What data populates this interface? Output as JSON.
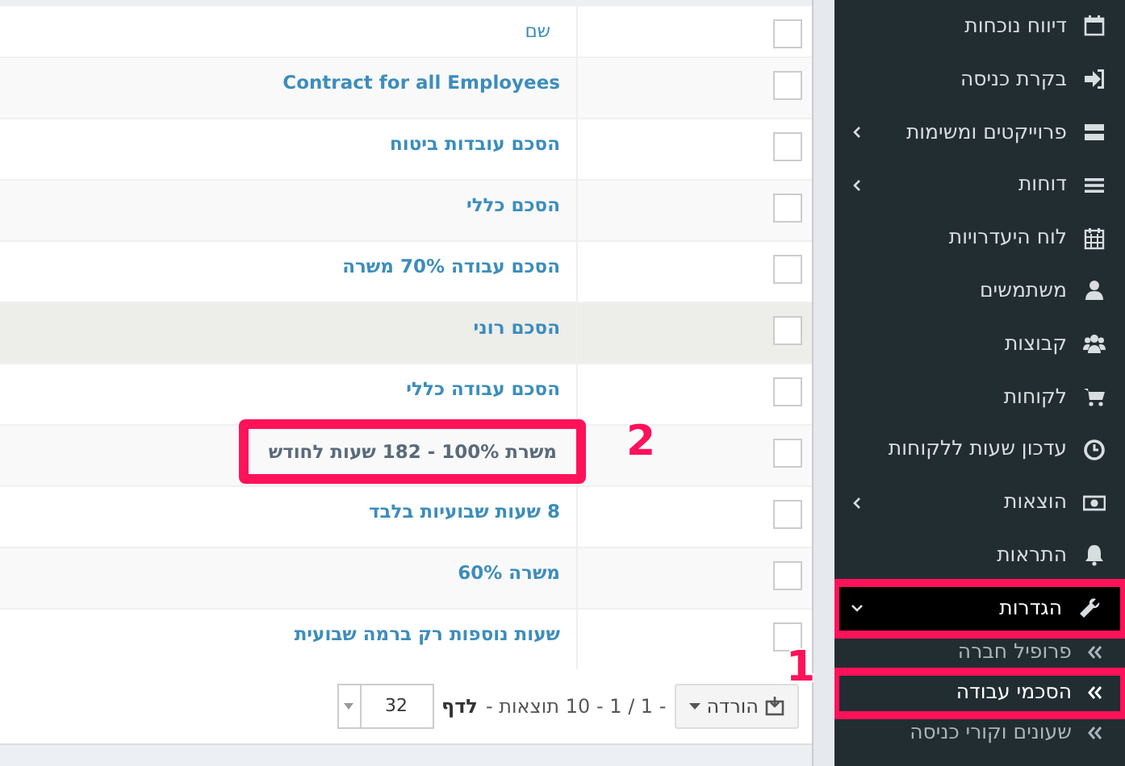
{
  "table": {
    "columns": [
      {
        "label": "שם"
      }
    ],
    "header_checkbox": {
      "checked": false
    },
    "rows": [
      {
        "name": "Contract for all Employees",
        "checked": false,
        "hovered": false,
        "outlined": false
      },
      {
        "name": "הסכם עובדות ביטוח",
        "checked": false,
        "hovered": false,
        "outlined": false
      },
      {
        "name": "הסכם כללי",
        "checked": false,
        "hovered": false,
        "outlined": false
      },
      {
        "name": "הסכם עבודה 70% משרה",
        "checked": false,
        "hovered": false,
        "outlined": false
      },
      {
        "name": "הסכם רוני",
        "checked": false,
        "hovered": true,
        "outlined": false
      },
      {
        "name": "הסכם עבודה כללי",
        "checked": false,
        "hovered": false,
        "outlined": false
      },
      {
        "name": "משרת 100% - 182 שעות לחודש",
        "checked": false,
        "hovered": false,
        "outlined": true
      },
      {
        "name": "8 שעות שבועיות בלבד",
        "checked": false,
        "hovered": false,
        "outlined": false
      },
      {
        "name": "משרה 60%",
        "checked": false,
        "hovered": false,
        "outlined": false
      },
      {
        "name": "שעות נוספות רק ברמה שבועית",
        "checked": false,
        "hovered": false,
        "outlined": false
      }
    ]
  },
  "footer": {
    "download_button": "הורדה",
    "page_info": "- 1 / 1 - 10 תוצאות -",
    "per_page_label": "לדף",
    "per_page_value": "32"
  },
  "sidebar": {
    "items": [
      {
        "label": "דיווח נוכחות",
        "has_children": false,
        "expanded": false,
        "outlined": false
      },
      {
        "label": "בקרת כניסה",
        "has_children": false,
        "expanded": false,
        "outlined": false
      },
      {
        "label": "פרוייקטים ומשימות",
        "has_children": true,
        "expanded": false,
        "outlined": false
      },
      {
        "label": "דוחות",
        "has_children": true,
        "expanded": false,
        "outlined": false
      },
      {
        "label": "לוח היעדרויות",
        "has_children": false,
        "expanded": false,
        "outlined": false
      },
      {
        "label": "משתמשים",
        "has_children": false,
        "expanded": false,
        "outlined": false
      },
      {
        "label": "קבוצות",
        "has_children": false,
        "expanded": false,
        "outlined": false
      },
      {
        "label": "לקוחות",
        "has_children": false,
        "expanded": false,
        "outlined": false
      },
      {
        "label": "עדכון שעות ללקוחות",
        "has_children": false,
        "expanded": false,
        "outlined": false
      },
      {
        "label": "הוצאות",
        "has_children": true,
        "expanded": false,
        "outlined": false
      },
      {
        "label": "התראות",
        "has_children": false,
        "expanded": false,
        "outlined": false
      },
      {
        "label": "הגדרות",
        "has_children": true,
        "expanded": true,
        "outlined": true,
        "children": [
          {
            "label": "פרופיל חברה",
            "selected": false,
            "outlined": false
          },
          {
            "label": "הסכמי עבודה",
            "selected": true,
            "outlined": true
          },
          {
            "label": "שעונים וקורי כניסה",
            "selected": false,
            "outlined": false
          }
        ]
      }
    ]
  },
  "annotations": [
    {
      "label": "2"
    },
    {
      "label": "1"
    }
  ]
}
